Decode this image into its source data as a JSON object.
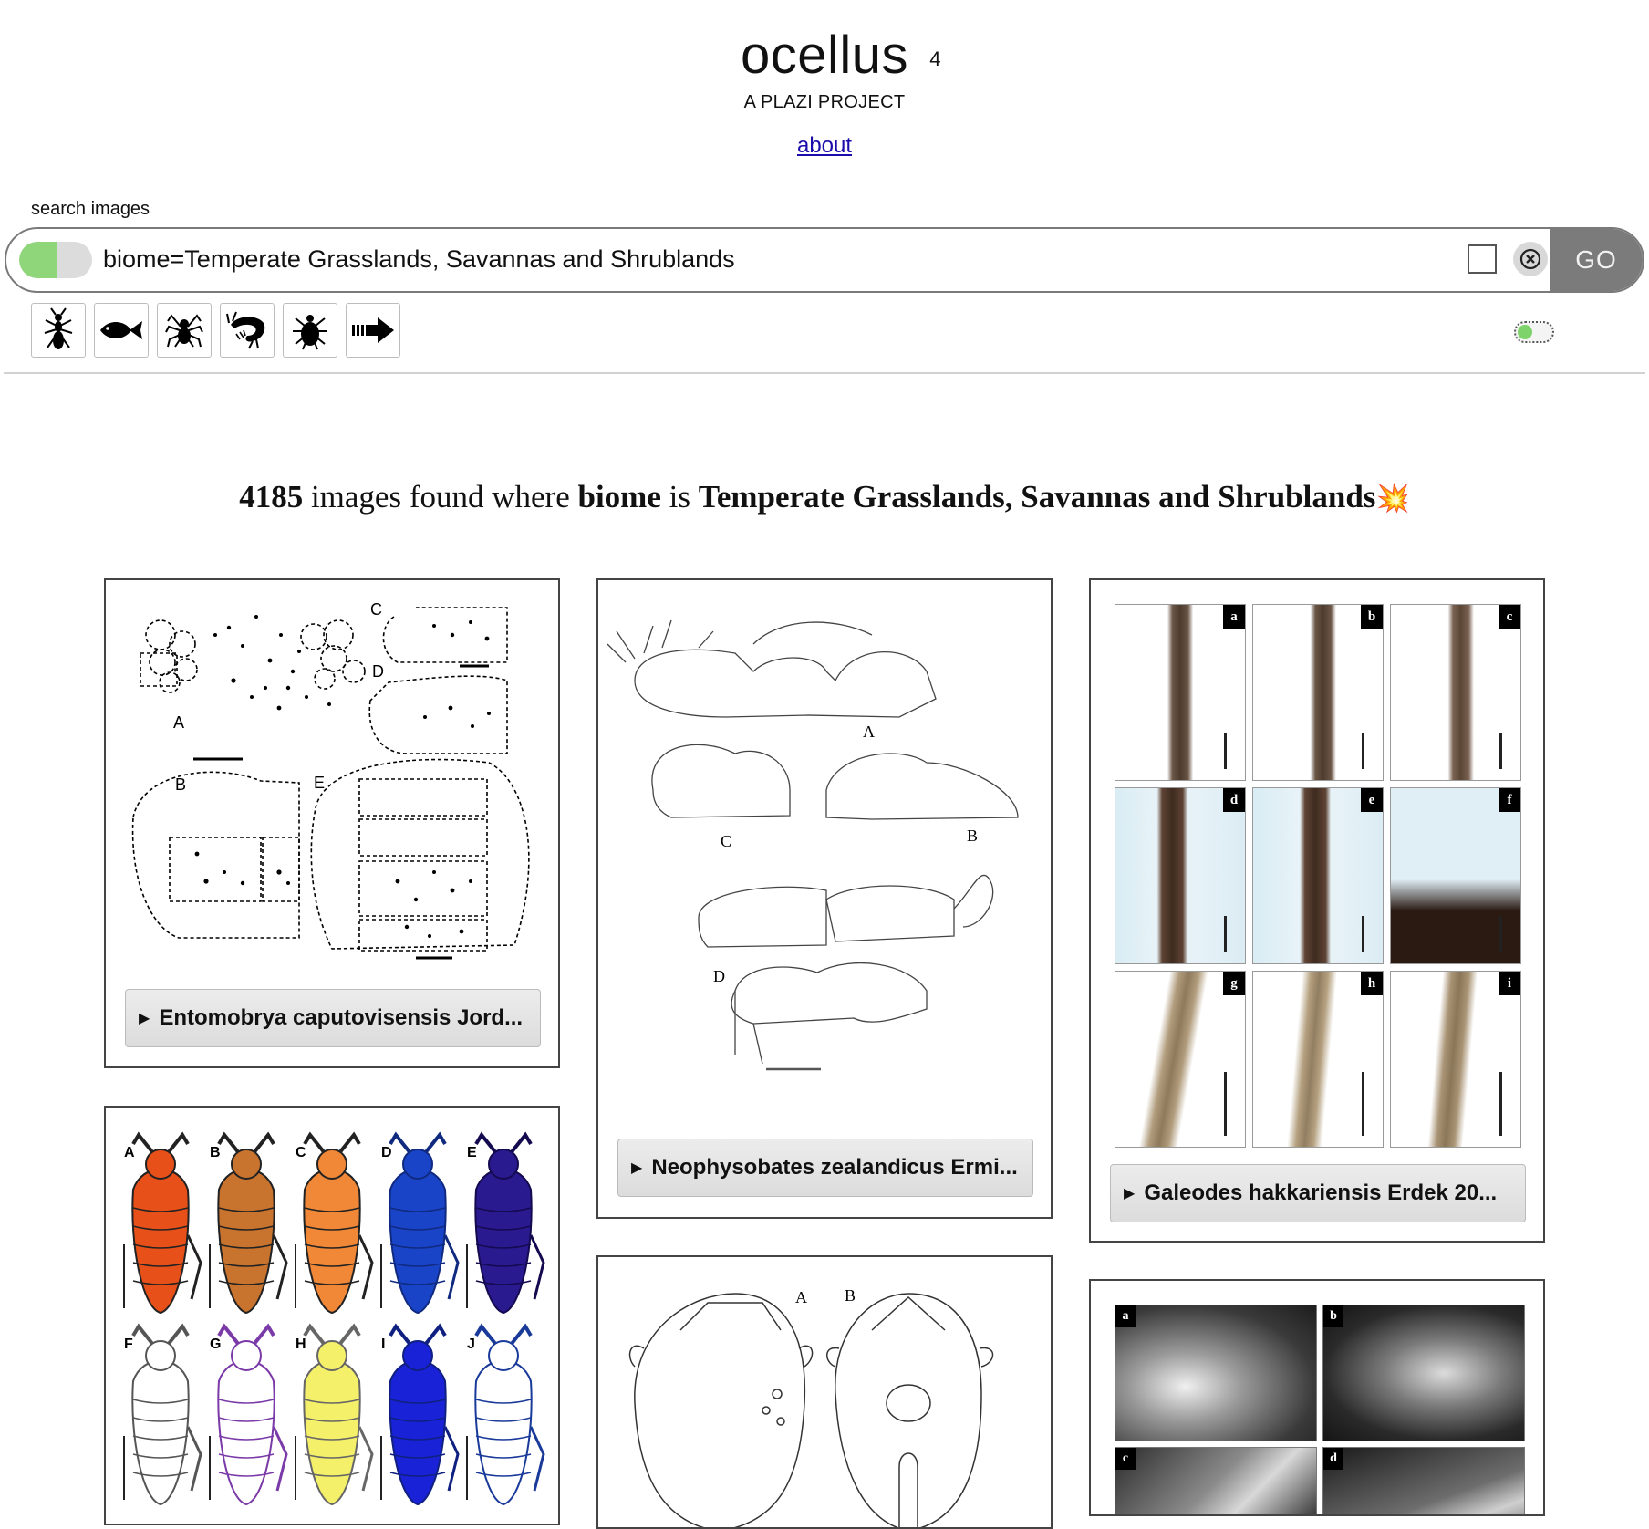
{
  "brand": {
    "title": "ocellus",
    "superscript": "4",
    "subtitle": "A PLAZI PROJECT",
    "about_link": "about"
  },
  "search": {
    "label": "search images",
    "query": "biome=Temperate Grasslands, Savannas and Shrublands",
    "go_label": "GO",
    "toggle_state": "on",
    "clear_icon": "circle-x-icon"
  },
  "taxon_buttons": [
    {
      "name": "insect",
      "icon": "ant-icon"
    },
    {
      "name": "fish",
      "icon": "fish-icon"
    },
    {
      "name": "spider",
      "icon": "spider-icon"
    },
    {
      "name": "shrimp",
      "icon": "shrimp-icon"
    },
    {
      "name": "tick",
      "icon": "tick-icon"
    },
    {
      "name": "more",
      "icon": "arrow-right-icon"
    }
  ],
  "results": {
    "count": "4185",
    "text_images_found": "images found where",
    "field": "biome",
    "text_is": "is",
    "value": "Temperate Grasslands, Savannas and Shrublands",
    "emoji": "💥"
  },
  "cards": [
    {
      "caption": "Entomobrya caputovisensis Jord..."
    },
    {
      "caption": "Neophysobates zealandicus Ermi..."
    },
    {
      "caption": "Galeodes hakkariensis Erdek 20..."
    },
    {
      "caption": ""
    },
    {
      "caption": ""
    },
    {
      "caption": ""
    }
  ],
  "card_figures": {
    "card3_panels": [
      "a",
      "b",
      "c",
      "d",
      "e",
      "f",
      "g",
      "h",
      "i"
    ],
    "card6_panels": [
      "a",
      "b",
      "c",
      "d"
    ],
    "card1_letters": [
      "A",
      "B",
      "C",
      "D",
      "E"
    ],
    "card2_letters": [
      "A",
      "B",
      "C",
      "D"
    ],
    "card4_letters": [
      "A",
      "B",
      "C",
      "D",
      "E",
      "F",
      "G",
      "H",
      "I",
      "J"
    ],
    "card5_letters": [
      "A",
      "B"
    ]
  },
  "colors": {
    "toggle_on": "#8fd67a",
    "go_button": "#7b7b7b",
    "link": "#1a0dab"
  }
}
